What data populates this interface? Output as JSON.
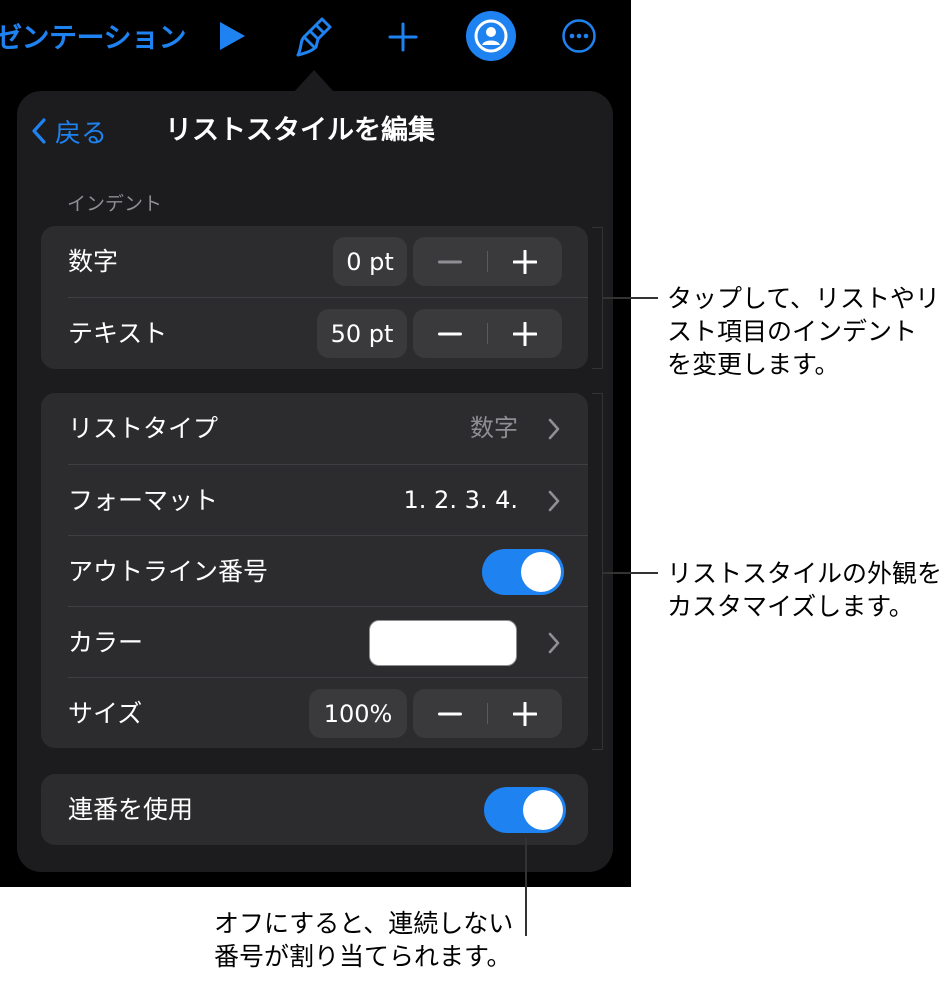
{
  "toolbar": {
    "app_title": "ゼンテーション",
    "icons": [
      "play-icon",
      "paintbrush-icon",
      "plus-icon",
      "collaborate-icon",
      "more-icon"
    ]
  },
  "popover": {
    "back_label": "戻る",
    "title": "リストスタイルを編集",
    "indent_section_label": "インデント",
    "indent": {
      "number": {
        "label": "数字",
        "value": "0 pt"
      },
      "text": {
        "label": "テキスト",
        "value": "50 pt"
      }
    },
    "list": {
      "list_type": {
        "label": "リストタイプ",
        "value": "数字"
      },
      "format": {
        "label": "フォーマット",
        "value": "1. 2. 3. 4."
      },
      "outline_numbers": {
        "label": "アウトライン番号",
        "on": true
      },
      "color": {
        "label": "カラー",
        "swatch": "#ffffff"
      },
      "size": {
        "label": "サイズ",
        "value": "100%"
      }
    },
    "continue_numbering": {
      "label": "連番を使用",
      "on": true
    }
  },
  "callouts": {
    "indent": [
      "タップして、リストやリ",
      "スト項目のインデント",
      "を変更します。"
    ],
    "style": [
      "リストスタイルの外観を",
      "カスタマイズします。"
    ],
    "numbering": [
      "オフにすると、連続しない",
      "番号が割り当てられます。"
    ]
  },
  "colors": {
    "accent": "#1e82f0",
    "panel": "#1c1c1e",
    "group": "#2c2c2e",
    "control": "#3a3a3c"
  }
}
